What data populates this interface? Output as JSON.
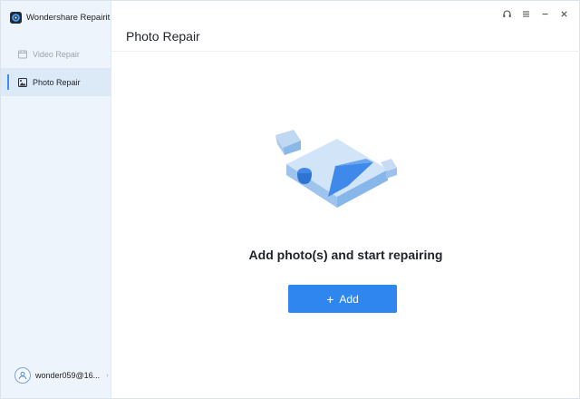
{
  "app": {
    "name": "Wondershare Repairit"
  },
  "sidebar": {
    "items": [
      {
        "label": "Video Repair",
        "icon": "video-icon",
        "active": false
      },
      {
        "label": "Photo Repair",
        "icon": "photo-icon",
        "active": true
      }
    ],
    "user": {
      "email": "wonder059@16...",
      "icon": "user-icon"
    }
  },
  "titlebar": {
    "buttons": [
      "headset-icon",
      "menu-icon",
      "minimize-icon",
      "close-icon"
    ]
  },
  "main": {
    "title": "Photo Repair",
    "prompt": "Add photo(s) and start repairing",
    "add_button": {
      "icon": "+",
      "label": "Add"
    }
  },
  "colors": {
    "accent": "#2f86ef",
    "sidebar_bg": "#eef4fb",
    "active_item_bg": "#dce9f7"
  }
}
